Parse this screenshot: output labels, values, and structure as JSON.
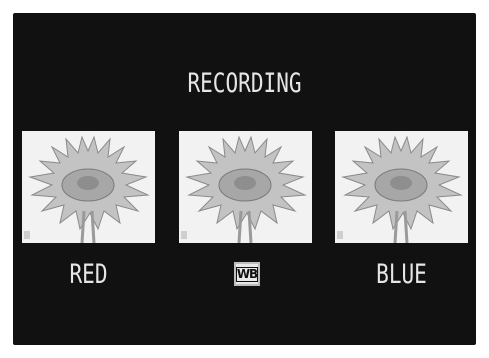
{
  "screen": {
    "title": "RECORDING"
  },
  "thumbnails": [
    {
      "label": "RED",
      "tint": "#f2f2f2"
    },
    {
      "label": "",
      "icon": "white-balance-icon",
      "icon_text": "WB",
      "tint": "#f2f2f2"
    },
    {
      "label": "BLUE",
      "tint": "#f2f2f2"
    }
  ],
  "colors": {
    "screen_bg": "#111111",
    "text": "#e6e6e6",
    "flower_fill": "#bdbdbd",
    "flower_center": "#8e8e8e"
  }
}
